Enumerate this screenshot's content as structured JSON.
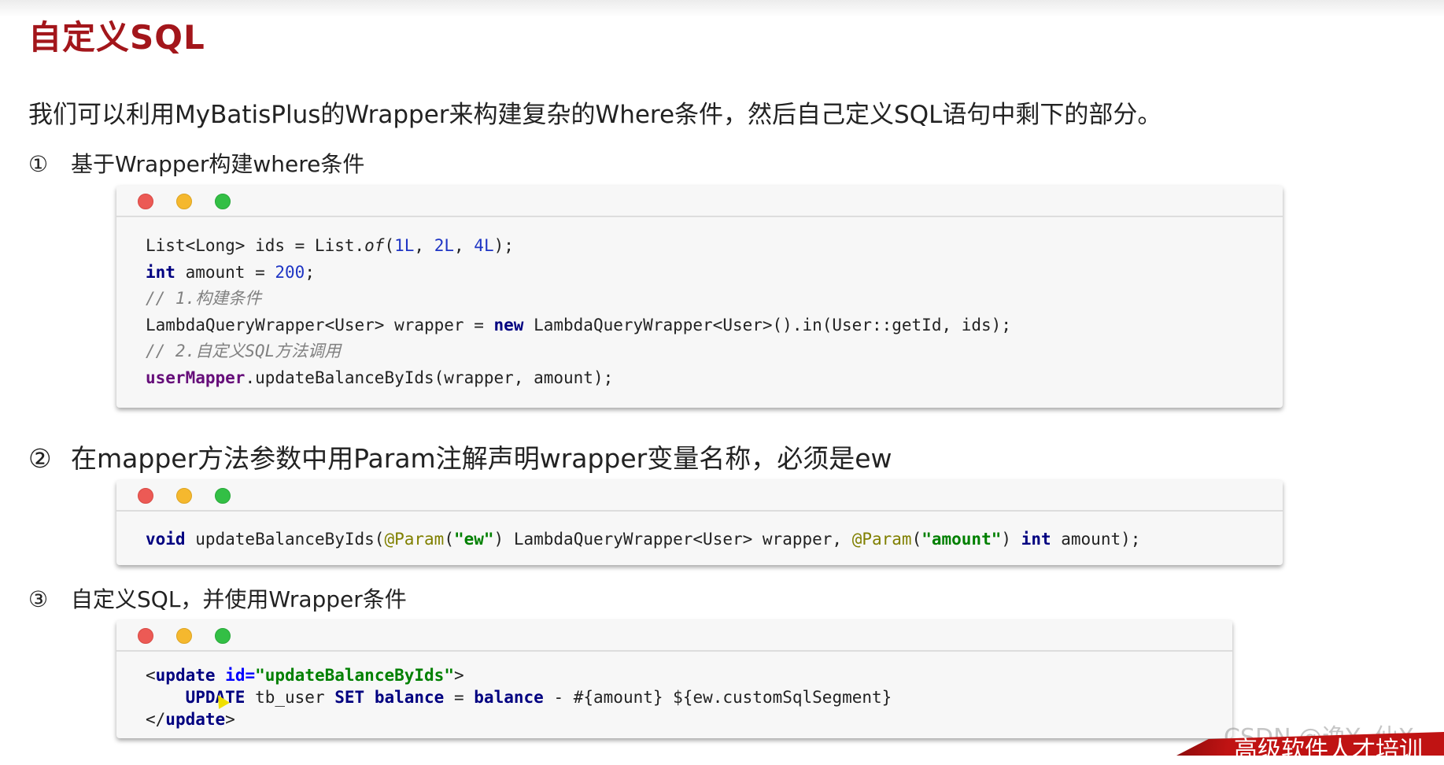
{
  "title": "自定义SQL",
  "intro": "我们可以利用MyBatisPlus的Wrapper来构建复杂的Where条件，然后自己定义SQL语句中剩下的部分。",
  "steps": [
    {
      "num": "①",
      "text": "基于Wrapper构建where条件"
    },
    {
      "num": "②",
      "text": "在mapper方法参数中用Param注解声明wrapper变量名称，必须是ew"
    },
    {
      "num": "③",
      "text": "自定义SQL，并使用Wrapper条件"
    }
  ],
  "code1": {
    "l1a": "List<Long> ids = List.",
    "l1b": "of",
    "l1c": "(",
    "n1": "1L",
    "c1": ", ",
    "n2": "2L",
    "c2": ", ",
    "n3": "4L",
    "l1d": ");",
    "l2kw": "int",
    "l2a": " amount = ",
    "l2n": "200",
    "l2b": ";",
    "l3": "// 1.构建条件",
    "l4a": "LambdaQueryWrapper<User> wrapper = ",
    "l4kw": "new",
    "l4b": " LambdaQueryWrapper<User>().in(User::getId, ids);",
    "l5": "// 2.自定义SQL方法调用",
    "l6m": "userMapper",
    "l6a": ".updateBalanceByIds(wrapper, amount);"
  },
  "code2": {
    "kw1": "void",
    "a": " updateBalanceByIds(",
    "an1": "@Param",
    "p1": "(",
    "s1": "\"ew\"",
    "b": ") LambdaQueryWrapper<User> wrapper, ",
    "an2": "@Param",
    "p2": "(",
    "s2": "\"amount\"",
    "c": ") ",
    "kw2": "int",
    "d": " amount);"
  },
  "code3": {
    "lt1": "<",
    "t1": "update",
    "sp": " ",
    "at": "id=",
    "av": "\"updateBalanceById s\"",
    "gt1": ">",
    "ind": "    ",
    "k1": "UPDATE",
    "m1": " tb_user ",
    "k2": "SET",
    "m2": " ",
    "k3": "balance",
    "m3": " = ",
    "k4": "balance",
    "m4": " - #{amount} ${ew.customSqlSegment}",
    "lt2": "</",
    "t2": "update",
    "gt2": ">"
  },
  "watermark": "CSDN @逸Y--仙X",
  "banner": "高级软件人才培训"
}
